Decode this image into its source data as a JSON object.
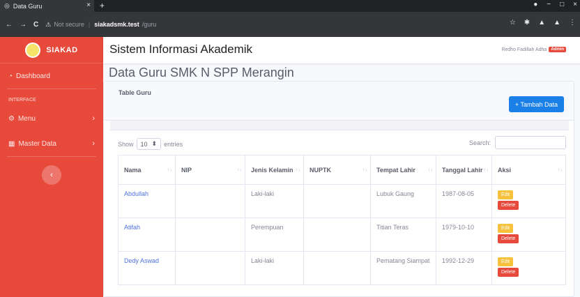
{
  "browser": {
    "tab_title": "Data Guru",
    "tab_close": "×",
    "new_tab": "+",
    "not_secure": "Not secure",
    "url_host": "siakadsmk.test",
    "url_path": "/guru",
    "win_min": "−",
    "win_max": "□",
    "win_close": "×",
    "back_icon": "←",
    "forward_icon": "→",
    "reload_icon": "C"
  },
  "sidebar": {
    "brand": "SIAKAD",
    "dashboard": "Dashboard",
    "heading": "INTERFACE",
    "menu": "Menu",
    "master_data": "Master Data",
    "chevron": "›",
    "toggle": "‹"
  },
  "topbar": {
    "title": "Sistem Informasi Akademik",
    "user": "Redho Fadillah Adha",
    "badge": "Admin"
  },
  "page": {
    "title": "Data Guru SMK N SPP Merangin"
  },
  "card": {
    "title": "Table Guru",
    "add_button": "+ Tambah Data"
  },
  "datatable": {
    "show_label": "Show",
    "entries_value": "10",
    "entries_label": "entries",
    "search_label": "Search:"
  },
  "table": {
    "headers": [
      "Nama",
      "NIP",
      "Jenis Kelamin",
      "NUPTK",
      "Tempat Lahir",
      "Tanggal Lahir",
      "Aksi"
    ],
    "sort_icon": "↑↓",
    "edit_label": "Edit",
    "delete_label": "Delete",
    "rows": [
      {
        "nama": "Abdullah",
        "nip": "",
        "jk": "Laki-laki",
        "nuptk": "",
        "tempat": "Lubuk Gaung",
        "tanggal": "1987-08-05"
      },
      {
        "nama": "Atifah",
        "nip": "",
        "jk": "Perempuan",
        "nuptk": "",
        "tempat": "Titian Teras",
        "tanggal": "1979-10-10"
      },
      {
        "nama": "Dedy Aswad",
        "nip": "",
        "jk": "Laki-laki",
        "nuptk": "",
        "tempat": "Pematang Siampat",
        "tanggal": "1992-12-29"
      }
    ]
  },
  "colors": {
    "sidebar": "#e74a3b",
    "primary": "#1a7fe6",
    "edit": "#f6c23e",
    "delete": "#e74a3b",
    "link": "#4e73df"
  }
}
